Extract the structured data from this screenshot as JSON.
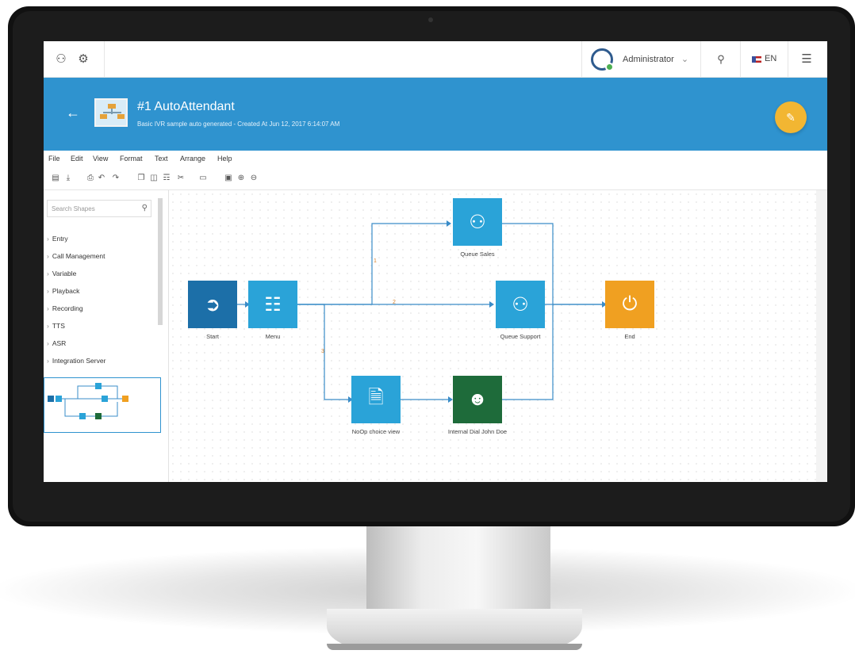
{
  "topbar": {
    "users_icon": "users-icon",
    "settings_icon": "gear-icon",
    "user_name": "Administrator",
    "search_icon": "search-icon",
    "language": "EN",
    "menu_icon": "list-menu-icon"
  },
  "header": {
    "title": "#1 AutoAttendant",
    "subtitle": "Basic IVR sample auto generated - Created At Jun 12, 2017 6:14:07 AM"
  },
  "menu": [
    "File",
    "Edit",
    "View",
    "Format",
    "Text",
    "Arrange",
    "Help"
  ],
  "sidebar": {
    "search_placeholder": "Search Shapes",
    "categories": [
      "Entry",
      "Call Management",
      "Variable",
      "Playback",
      "Recording",
      "TTS",
      "ASR",
      "Integration Server"
    ]
  },
  "flow": {
    "nodes": [
      {
        "id": "start",
        "label": "Start",
        "color": "#1c6fa8",
        "icon": "exit-icon"
      },
      {
        "id": "menu",
        "label": "Menu",
        "color": "#2aa3d8",
        "icon": "sitemap-icon"
      },
      {
        "id": "queue_sales",
        "label": "Queue Sales",
        "color": "#2aa3d8",
        "icon": "users-icon"
      },
      {
        "id": "queue_support",
        "label": "Queue Support",
        "color": "#2aa3d8",
        "icon": "users-icon"
      },
      {
        "id": "end",
        "label": "End",
        "color": "#f0a021",
        "icon": "power-icon"
      },
      {
        "id": "noop",
        "label": "NoOp choice view",
        "color": "#2aa3d8",
        "icon": "document-icon"
      },
      {
        "id": "dial",
        "label": "Internal Dial John Doe",
        "color": "#1e6b3a",
        "icon": "user-icon"
      }
    ],
    "edge_labels": [
      "1",
      "2",
      "3"
    ]
  },
  "colors": {
    "header_band": "#2f93cf",
    "accent_fab": "#f2b632",
    "edge": "#3a8cc8"
  }
}
